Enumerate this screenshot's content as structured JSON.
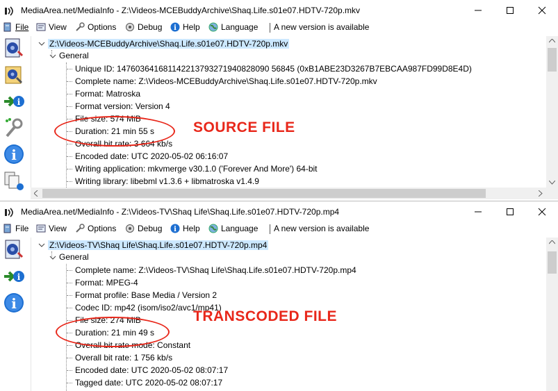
{
  "window1": {
    "title": "MediaArea.net/MediaInfo - Z:\\Videos-MCEBuddyArchive\\Shaq.Life.s01e07.HDTV-720p.mkv",
    "menu": {
      "file": "File",
      "view": "View",
      "options": "Options",
      "debug": "Debug",
      "help": "Help",
      "language": "Language",
      "new_version": "A new version is available"
    },
    "tree": {
      "root": "Z:\\Videos-MCEBuddyArchive\\Shaq.Life.s01e07.HDTV-720p.mkv",
      "section": "General",
      "fields": [
        "Unique ID: 147603641681142213793271940828090 56845 (0xB1ABE23D3267B7EBCAA987FD99D8E4D)",
        "Complete name: Z:\\Videos-MCEBuddyArchive\\Shaq.Life.s01e07.HDTV-720p.mkv",
        "Format: Matroska",
        "Format version: Version 4",
        "File size: 574 MiB",
        "Duration: 21 min 55 s",
        "Overall bit rate: 3 664 kb/s",
        "Encoded date: UTC 2020-05-02 06:16:07",
        "Writing application: mkvmerge v30.1.0 ('Forever And More') 64-bit",
        "Writing library: libebml v1.3.6 + libmatroska v1.4.9"
      ]
    },
    "annotation": "SOURCE FILE"
  },
  "window2": {
    "title": "MediaArea.net/MediaInfo - Z:\\Videos-TV\\Shaq Life\\Shaq.Life.s01e07.HDTV-720p.mp4",
    "menu": {
      "file": "File",
      "view": "View",
      "options": "Options",
      "debug": "Debug",
      "help": "Help",
      "language": "Language",
      "new_version": "A new version is available"
    },
    "tree": {
      "root": "Z:\\Videos-TV\\Shaq Life\\Shaq.Life.s01e07.HDTV-720p.mp4",
      "section": "General",
      "fields": [
        "Complete name: Z:\\Videos-TV\\Shaq Life\\Shaq.Life.s01e07.HDTV-720p.mp4",
        "Format: MPEG-4",
        "Format profile: Base Media / Version 2",
        "Codec ID: mp42 (isom/iso2/avc1/mp41)",
        "File size: 274 MiB",
        "Duration: 21 min 49 s",
        "Overall bit rate mode: Constant",
        "Overall bit rate: 1 756 kb/s",
        "Encoded date: UTC 2020-05-02 08:07:17",
        "Tagged date: UTC 2020-05-02 08:07:17"
      ]
    },
    "annotation": "TRANSCODED FILE"
  },
  "colors": {
    "annotation": "#e8271a",
    "selection": "#cce8ff"
  }
}
